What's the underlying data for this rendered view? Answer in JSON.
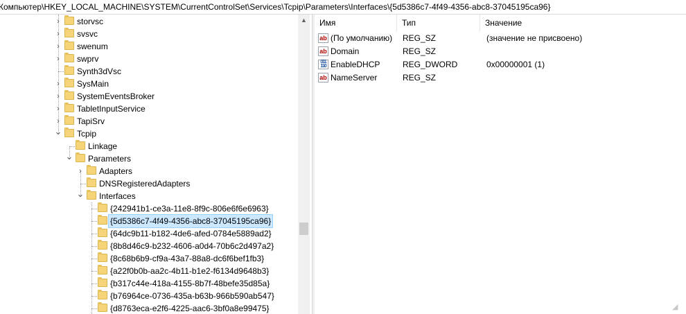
{
  "address": "Компьютер\\HKEY_LOCAL_MACHINE\\SYSTEM\\CurrentControlSet\\Services\\Tcpip\\Parameters\\Interfaces\\{5d5386c7-4f49-4356-abc8-37045195ca96}",
  "tree": [
    {
      "label": "storvsc",
      "level": 0,
      "expander": "collapsed"
    },
    {
      "label": "svsvc",
      "level": 0,
      "expander": "collapsed"
    },
    {
      "label": "swenum",
      "level": 0,
      "expander": "collapsed"
    },
    {
      "label": "swprv",
      "level": 0,
      "expander": "collapsed"
    },
    {
      "label": "Synth3dVsc",
      "level": 0,
      "expander": "none"
    },
    {
      "label": "SysMain",
      "level": 0,
      "expander": "collapsed"
    },
    {
      "label": "SystemEventsBroker",
      "level": 0,
      "expander": "collapsed"
    },
    {
      "label": "TabletInputService",
      "level": 0,
      "expander": "collapsed"
    },
    {
      "label": "TapiSrv",
      "level": 0,
      "expander": "collapsed"
    },
    {
      "label": "Tcpip",
      "level": 0,
      "expander": "expanded"
    },
    {
      "label": "Linkage",
      "level": 1,
      "expander": "none"
    },
    {
      "label": "Parameters",
      "level": 1,
      "expander": "expanded"
    },
    {
      "label": "Adapters",
      "level": 2,
      "expander": "collapsed"
    },
    {
      "label": "DNSRegisteredAdapters",
      "level": 2,
      "expander": "none"
    },
    {
      "label": "Interfaces",
      "level": 2,
      "expander": "expanded"
    },
    {
      "label": "{242941b1-ce3a-11e8-8f9c-806e6f6e6963}",
      "level": 3,
      "expander": "none"
    },
    {
      "label": "{5d5386c7-4f49-4356-abc8-37045195ca96}",
      "level": 3,
      "expander": "none",
      "selected": true
    },
    {
      "label": "{64dc9b11-b182-4de6-afed-0784e5889ad2}",
      "level": 3,
      "expander": "none"
    },
    {
      "label": "{8b8d46c9-b232-4606-a0d4-70b6c2d497a2}",
      "level": 3,
      "expander": "none"
    },
    {
      "label": "{8c68b6b9-cf9a-43a7-88a8-dc6f6bef1fb3}",
      "level": 3,
      "expander": "none"
    },
    {
      "label": "{a22f0b0b-aa2c-4b11-b1e2-f6134d9648b3}",
      "level": 3,
      "expander": "none"
    },
    {
      "label": "{b317c44e-418a-4155-8b7f-48befe35d85a}",
      "level": 3,
      "expander": "none"
    },
    {
      "label": "{b76964ce-0736-435a-b63b-966b590ab547}",
      "level": 3,
      "expander": "none"
    },
    {
      "label": "{d8763eca-e2f6-4225-aac6-3bf0a8e99475}",
      "level": 3,
      "expander": "none"
    }
  ],
  "columns": {
    "name": "Имя",
    "type": "Тип",
    "value": "Значение"
  },
  "values": [
    {
      "name": "(По умолчанию)",
      "type": "REG_SZ",
      "data": "(значение не присвоено)",
      "icon": "string-value-icon"
    },
    {
      "name": "Domain",
      "type": "REG_SZ",
      "data": "",
      "icon": "string-value-icon"
    },
    {
      "name": "EnableDHCP",
      "type": "REG_DWORD",
      "data": "0x00000001 (1)",
      "icon": "dword-value-icon"
    },
    {
      "name": "NameServer",
      "type": "REG_SZ",
      "data": "",
      "icon": "string-value-icon"
    }
  ],
  "icon_glyphs": {
    "string": "ab",
    "dword": "011\n110"
  }
}
